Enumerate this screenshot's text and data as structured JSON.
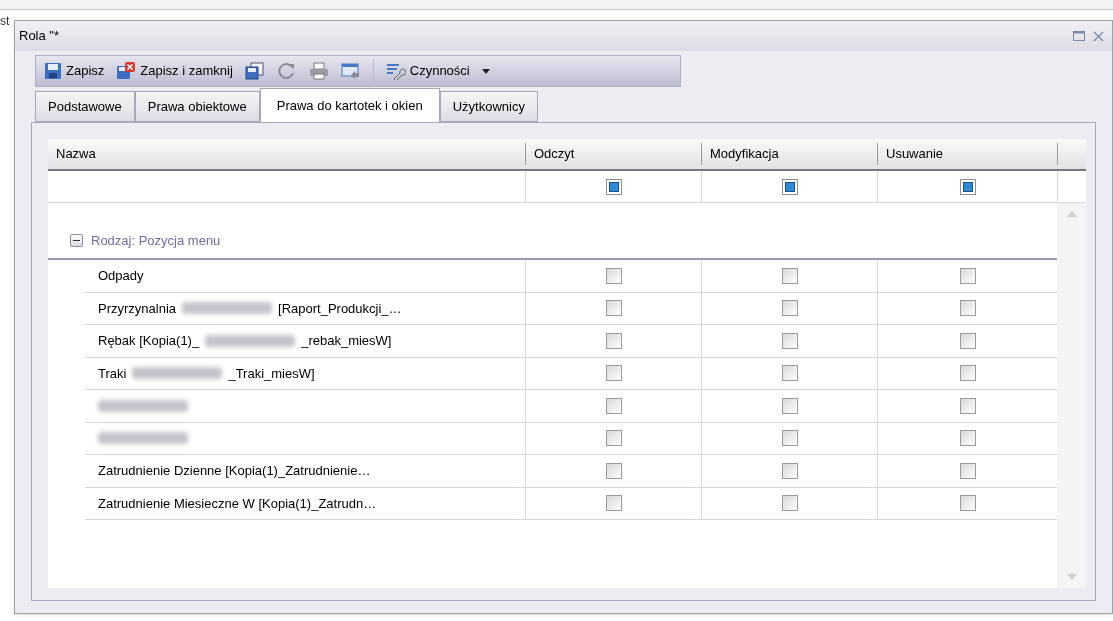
{
  "background_text": "st",
  "window": {
    "title": "Rola \"*"
  },
  "toolbar": [
    {
      "kind": "save",
      "label": "Zapisz"
    },
    {
      "kind": "save_close",
      "label": "Zapisz i zamknij"
    },
    {
      "kind": "copy"
    },
    {
      "kind": "refresh"
    },
    {
      "kind": "print"
    },
    {
      "kind": "window"
    },
    {
      "kind": "separator"
    },
    {
      "kind": "actions",
      "label": "Czynności"
    }
  ],
  "tabs": [
    {
      "label": "Podstawowe",
      "selected": false
    },
    {
      "label": "Prawa obiektowe",
      "selected": false
    },
    {
      "label": "Prawa do kartotek i okien",
      "selected": true
    },
    {
      "label": "Użytkownicy",
      "selected": false
    }
  ],
  "table": {
    "columns": [
      "Nazwa",
      "Odczyt",
      "Modyfikacja",
      "Usuwanie"
    ],
    "filter_row": [
      {
        "checked": true
      },
      {
        "checked": true
      },
      {
        "checked": true
      }
    ],
    "group": {
      "label": "Rodzaj: Pozycja menu",
      "expanded": true
    },
    "rows": [
      {
        "name": [
          {
            "kind": "text",
            "text": "Odpady"
          }
        ],
        "checks": [
          {
            "checked": false
          },
          {
            "checked": false
          },
          {
            "checked": false
          }
        ]
      },
      {
        "name": [
          {
            "kind": "text",
            "text": "Przyrzynalnia"
          },
          {
            "kind": "blurred"
          },
          {
            "kind": "text",
            "text": "[Raport_Produkcji_…"
          }
        ],
        "checks": [
          {
            "checked": false
          },
          {
            "checked": false
          },
          {
            "checked": false
          }
        ]
      },
      {
        "name": [
          {
            "kind": "text",
            "text": "Rębak [Kopia(1)_"
          },
          {
            "kind": "blurred"
          },
          {
            "kind": "text",
            "text": "_rebak_miesW]"
          }
        ],
        "checks": [
          {
            "checked": false
          },
          {
            "checked": false
          },
          {
            "checked": false
          }
        ]
      },
      {
        "name": [
          {
            "kind": "text",
            "text": "Traki"
          },
          {
            "kind": "blurred"
          },
          {
            "kind": "text",
            "text": "_Traki_miesW]"
          }
        ],
        "checks": [
          {
            "checked": false
          },
          {
            "checked": false
          },
          {
            "checked": false
          }
        ]
      },
      {
        "name": [
          {
            "kind": "blurred"
          }
        ],
        "checks": [
          {
            "checked": false
          },
          {
            "checked": false
          },
          {
            "checked": false
          }
        ]
      },
      {
        "name": [
          {
            "kind": "blurred"
          }
        ],
        "checks": [
          {
            "checked": false
          },
          {
            "checked": false
          },
          {
            "checked": false
          }
        ]
      },
      {
        "name": [
          {
            "kind": "text",
            "text": "Zatrudnienie Dzienne [Kopia(1)_Zatrudnienie…"
          }
        ],
        "checks": [
          {
            "checked": false
          },
          {
            "checked": false
          },
          {
            "checked": false
          }
        ]
      },
      {
        "name": [
          {
            "kind": "text",
            "text": "Zatrudnienie Miesieczne W [Kopia(1)_Zatrudn…"
          }
        ],
        "checks": [
          {
            "checked": false
          },
          {
            "checked": false
          },
          {
            "checked": false
          }
        ]
      }
    ]
  }
}
